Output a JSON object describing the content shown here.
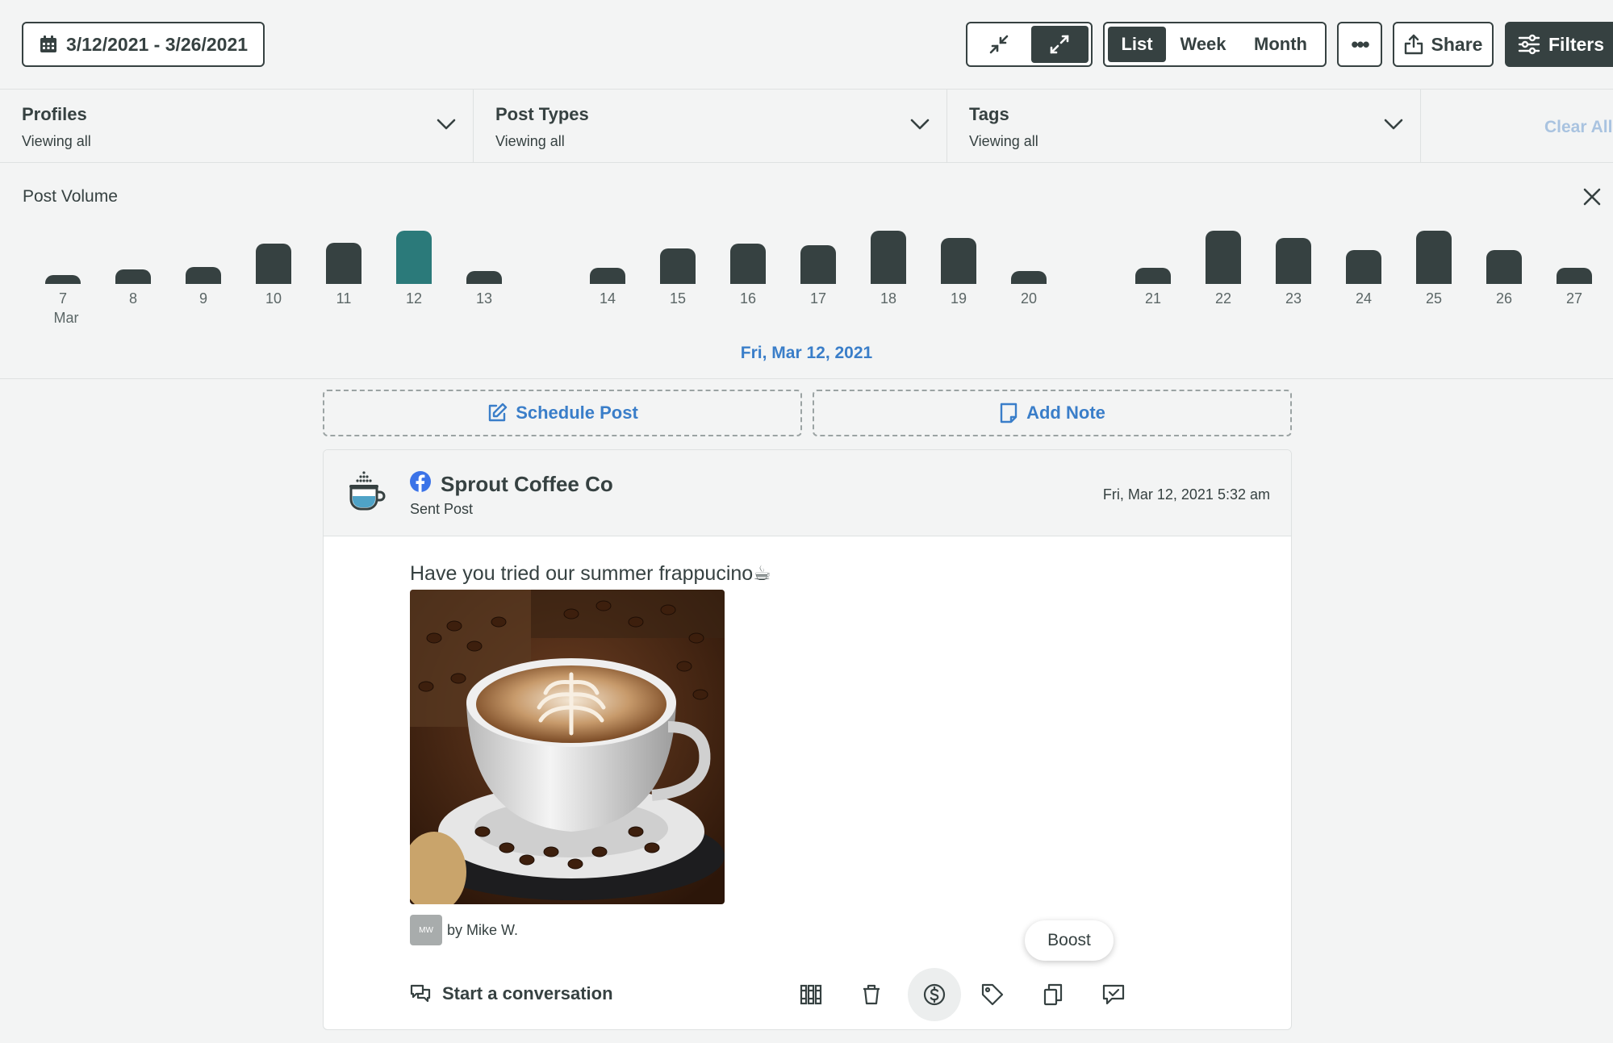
{
  "toolbar": {
    "date_range": "3/12/2021 - 3/26/2021",
    "view_tabs": [
      "List",
      "Week",
      "Month"
    ],
    "active_view": "List",
    "more_label": "•••",
    "share_label": "Share",
    "filters_label": "Filters"
  },
  "filters": {
    "items": [
      {
        "title": "Profiles",
        "sub": "Viewing all"
      },
      {
        "title": "Post Types",
        "sub": "Viewing all"
      },
      {
        "title": "Tags",
        "sub": "Viewing all"
      }
    ],
    "clear_all": "Clear All"
  },
  "volume": {
    "title": "Post Volume",
    "month_label": "Mar",
    "selected_date": "Fri, Mar 12, 2021",
    "days": [
      {
        "label": "7",
        "level": 0.16
      },
      {
        "label": "8",
        "level": 0.28
      },
      {
        "label": "9",
        "level": 0.32
      },
      {
        "label": "10",
        "level": 0.75
      },
      {
        "label": "11",
        "level": 0.78
      },
      {
        "label": "12",
        "level": 1.0,
        "selected": true
      },
      {
        "label": "13",
        "level": 0.24
      },
      {
        "label": "14",
        "level": 0.3
      },
      {
        "label": "15",
        "level": 0.67
      },
      {
        "label": "16",
        "level": 0.75
      },
      {
        "label": "17",
        "level": 0.73
      },
      {
        "label": "18",
        "level": 1.0
      },
      {
        "label": "19",
        "level": 0.86
      },
      {
        "label": "20",
        "level": 0.24
      },
      {
        "label": "21",
        "level": 0.3
      },
      {
        "label": "22",
        "level": 1.0
      },
      {
        "label": "23",
        "level": 0.86
      },
      {
        "label": "24",
        "level": 0.63
      },
      {
        "label": "25",
        "level": 1.0
      },
      {
        "label": "26",
        "level": 0.63
      },
      {
        "label": "27",
        "level": 0.3
      }
    ],
    "colors": {
      "bar": "#364141",
      "selected": "#2b7a7a"
    }
  },
  "actions": {
    "schedule": "Schedule Post",
    "note": "Add Note"
  },
  "post": {
    "profile": "Sprout Coffee Co",
    "kind": "Sent Post",
    "time": "Fri, Mar 12, 2021 5:32 am",
    "text": "Have you tried our summer frappucino☕",
    "author_initials": "MW",
    "author": "by Mike W.",
    "boost_tooltip": "Boost",
    "conversation": "Start a conversation"
  }
}
